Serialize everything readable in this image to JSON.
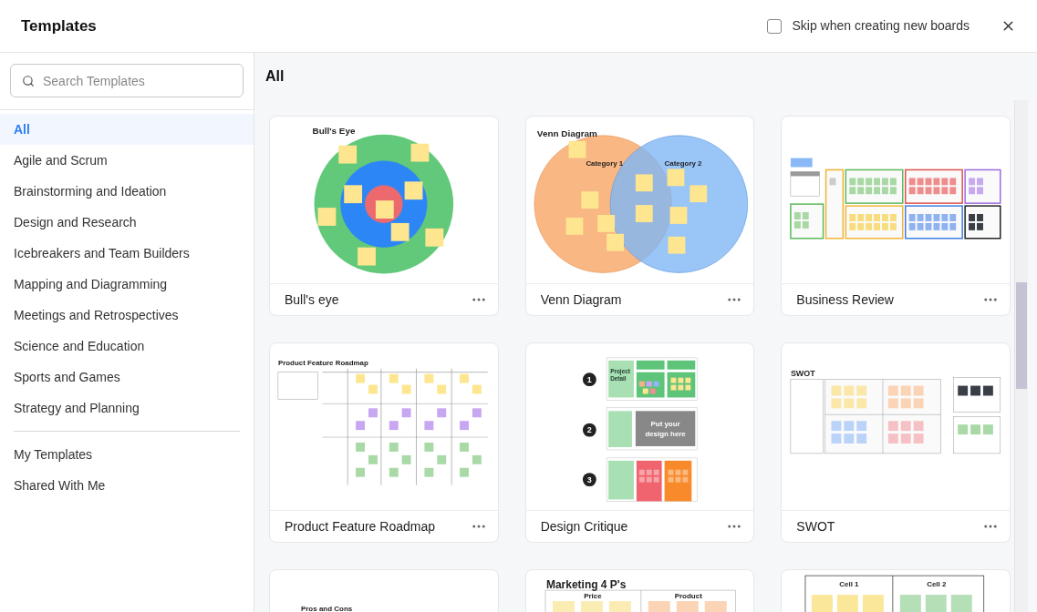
{
  "header": {
    "title": "Templates",
    "skip_option": {
      "label": "Skip when creating new boards",
      "checked": false
    }
  },
  "search": {
    "placeholder": "Search Templates"
  },
  "categories": [
    {
      "label": "All",
      "selected": true
    },
    {
      "label": "Agile and Scrum",
      "selected": false
    },
    {
      "label": "Brainstorming and Ideation",
      "selected": false
    },
    {
      "label": "Design and Research",
      "selected": false
    },
    {
      "label": "Icebreakers and Team Builders",
      "selected": false
    },
    {
      "label": "Mapping and Diagramming",
      "selected": false
    },
    {
      "label": "Meetings and Retrospectives",
      "selected": false
    },
    {
      "label": "Science and Education",
      "selected": false
    },
    {
      "label": "Sports and Games",
      "selected": false
    },
    {
      "label": "Strategy and Planning",
      "selected": false
    }
  ],
  "personal": [
    {
      "label": "My Templates",
      "selected": false
    },
    {
      "label": "Shared With Me",
      "selected": false
    }
  ],
  "section_title": "All",
  "templates": [
    {
      "kind": "bullseye",
      "name": "Bull's eye",
      "preview_texts": [
        "Bull's Eye"
      ]
    },
    {
      "kind": "venn",
      "name": "Venn Diagram",
      "preview_texts": [
        "Venn Diagram",
        "Category 1",
        "Category 2"
      ]
    },
    {
      "kind": "business-review",
      "name": "Business Review"
    },
    {
      "kind": "roadmap",
      "name": "Product Feature Roadmap",
      "preview_texts": [
        "Product Feature Roadmap"
      ]
    },
    {
      "kind": "critique",
      "name": "Design Critique",
      "preview_texts": [
        "1",
        "2",
        "3",
        "Project Detail",
        "Put your design here"
      ]
    },
    {
      "kind": "swot",
      "name": "SWOT",
      "preview_texts": [
        "SWOT"
      ]
    },
    {
      "kind": "pros-cons",
      "preview_texts": [
        "Pros and Cons"
      ]
    },
    {
      "kind": "marketing",
      "preview_texts": [
        "Marketing 4 P's",
        "Price",
        "Product"
      ]
    },
    {
      "kind": "cells",
      "preview_texts": [
        "Cell 1",
        "Cell 2"
      ]
    }
  ]
}
